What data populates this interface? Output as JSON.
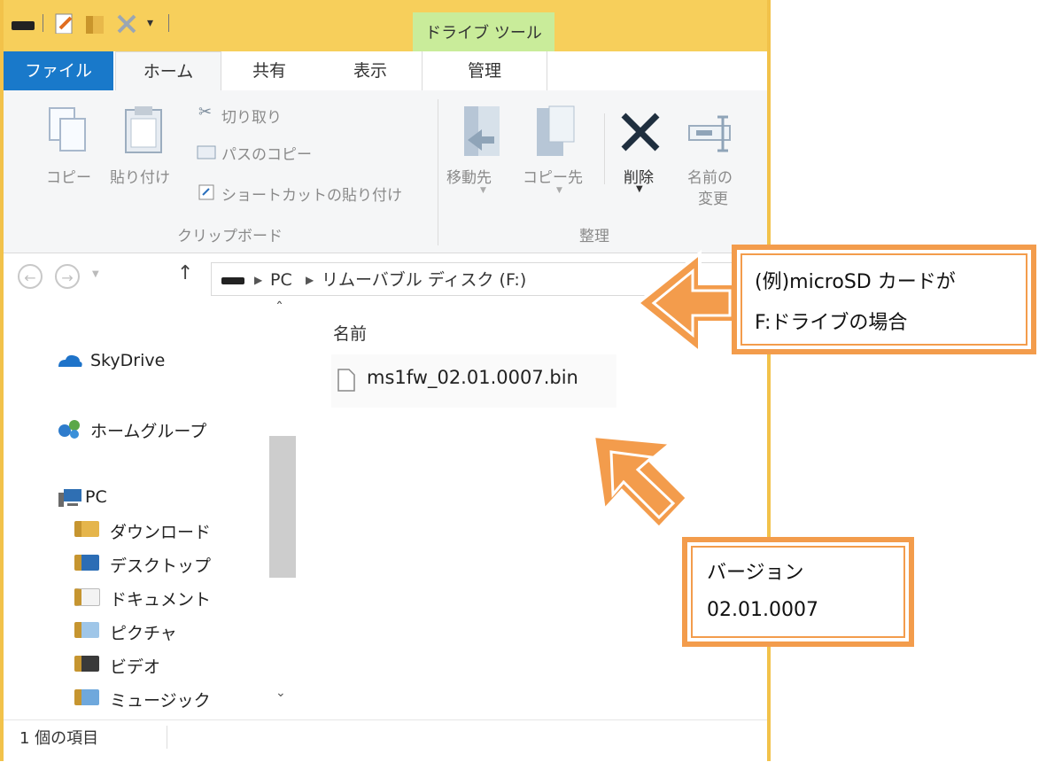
{
  "titlebar": {
    "drive_tools": "ドライブ ツール"
  },
  "tabs": {
    "file": "ファイル",
    "home": "ホーム",
    "share": "共有",
    "view": "表示",
    "manage": "管理"
  },
  "clipboard": {
    "copy": "コピー",
    "paste": "貼り付け",
    "cut": "切り取り",
    "copy_path": "パスのコピー",
    "paste_shortcut": "ショートカットの貼り付け",
    "group_label": "クリップボード"
  },
  "organize": {
    "move_to": "移動先",
    "copy_to": "コピー先",
    "delete": "削除",
    "rename_line1": "名前の",
    "rename_line2": "変更",
    "group_label": "整理"
  },
  "address": {
    "pc": "PC",
    "drive": "リムーバブル ディスク (F:)"
  },
  "nav": {
    "skydrive": "SkyDrive",
    "homegroup": "ホームグループ",
    "pc": "PC",
    "downloads": "ダウンロード",
    "desktop": "デスクトップ",
    "documents": "ドキュメント",
    "pictures": "ピクチャ",
    "videos": "ビデオ",
    "music": "ミュージック"
  },
  "content": {
    "column_name": "名前",
    "file_name": "ms1fw_02.01.0007.bin"
  },
  "status": {
    "item_count": "1 個の項目"
  },
  "callouts": {
    "drive_line1": "(例)microSD  カードが",
    "drive_line2": "F:ドライブの場合",
    "version_line1": "バージョン",
    "version_line2": "02.01.0007"
  },
  "colors": {
    "accent": "#f39c4c",
    "file_tab": "#1979ca",
    "title_bar": "#f7cf5b",
    "drive_tools": "#c9ec9a"
  }
}
